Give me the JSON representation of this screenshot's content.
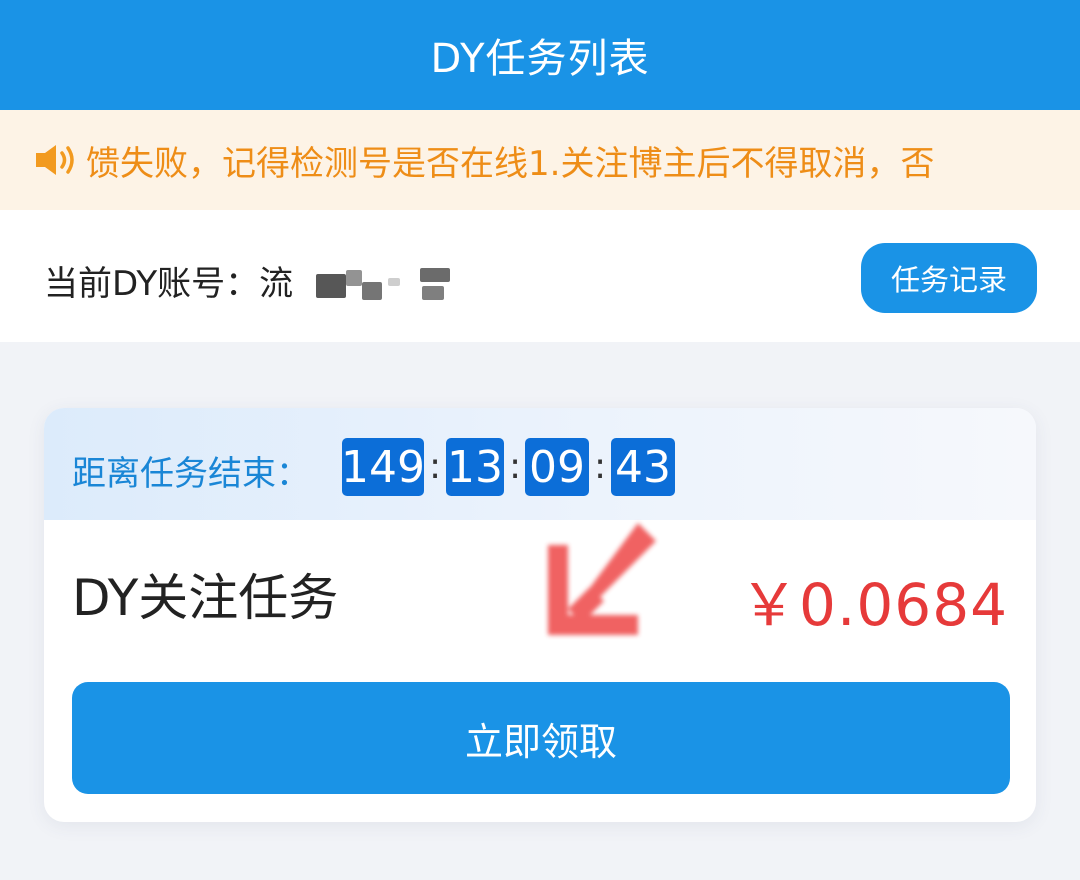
{
  "header": {
    "title": "DY任务列表"
  },
  "notice": {
    "icon": "speaker-icon",
    "text": "馈失败，记得检测号是否在线1.关注博主后不得取消，否",
    "color": "#ee8d17"
  },
  "account": {
    "label": "当前DY账号：",
    "value_visible": "流",
    "records_button": "任务记录"
  },
  "task": {
    "countdown_label": "距离任务结束：",
    "countdown": {
      "days": "149",
      "hours": "13",
      "minutes": "09",
      "seconds": "43"
    },
    "separator": ":",
    "title": "DY关注任务",
    "reward": "￥0.0684",
    "claim_button": "立即领取"
  },
  "colors": {
    "primary": "#1a93e6",
    "timer_box": "#0c6ed8",
    "reward": "#e63a3a",
    "notice_bg": "#fdf3e6",
    "arrow": "#f05a5a"
  }
}
